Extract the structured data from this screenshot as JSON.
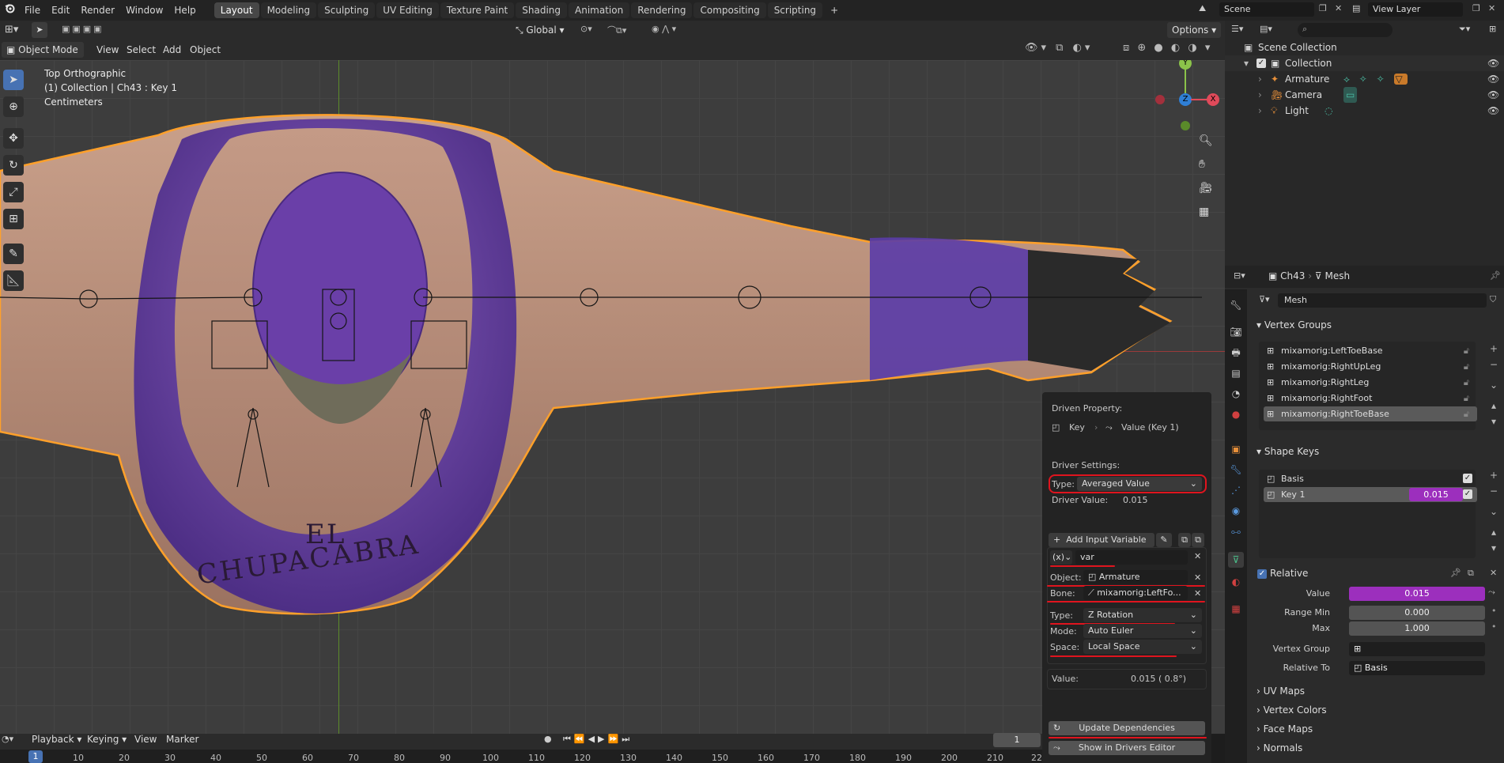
{
  "topbar": {
    "menus": [
      "File",
      "Edit",
      "Render",
      "Window",
      "Help"
    ],
    "workspaces": [
      "Layout",
      "Modeling",
      "Sculpting",
      "UV Editing",
      "Texture Paint",
      "Shading",
      "Animation",
      "Rendering",
      "Compositing",
      "Scripting"
    ],
    "active_workspace": "Layout",
    "add_tab": "+",
    "scene": "Scene",
    "view_layer": "View Layer"
  },
  "vp_toolbar": {
    "transform_orientation": "Global",
    "options": "Options"
  },
  "vp_header": {
    "mode": "Object Mode",
    "view": "View",
    "select": "Select",
    "add": "Add",
    "object": "Object"
  },
  "viewport": {
    "view_name": "Top Orthographic",
    "collection_info": "(1) Collection | Ch43 : Key 1",
    "units": "Centimeters",
    "shirt_text_1": "EL",
    "shirt_text_2": "CHUPACABRA",
    "gizmo_y": "Y",
    "gizmo_z": "Z",
    "gizmo_x": "X"
  },
  "driver_popover": {
    "driven_property_label": "Driven Property:",
    "driven_key": "Key",
    "driven_value": "Value (Key 1)",
    "driver_settings_label": "Driver Settings:",
    "type_label": "Type:",
    "type_value": "Averaged Value",
    "driver_value_label": "Driver Value:",
    "driver_value": "0.015",
    "add_input_variable": "Add Input Variable",
    "var_type": "(x)",
    "var_name": "var",
    "object_label": "Object:",
    "object_value": "Armature",
    "bone_label": "Bone:",
    "bone_value": "mixamorig:LeftFo...",
    "vtype_label": "Type:",
    "vtype_value": "Z Rotation",
    "mode_label": "Mode:",
    "mode_value": "Auto Euler",
    "space_label": "Space:",
    "space_value": "Local Space",
    "value_label": "Value:",
    "value_value": "0.015 ( 0.8°)",
    "update_dependencies": "Update Dependencies",
    "show_in_drivers_editor": "Show in Drivers Editor",
    "highlight_color": "#e0141e"
  },
  "outliner": {
    "scene_collection": "Scene Collection",
    "collection": "Collection",
    "items": [
      "Armature",
      "Camera",
      "Light"
    ]
  },
  "properties": {
    "breadcrumb_object": "Ch43",
    "breadcrumb_data": "Mesh",
    "mesh_name": "Mesh",
    "vertex_groups_title": "Vertex Groups",
    "vertex_groups": [
      "mixamorig:LeftToeBase",
      "mixamorig:RightUpLeg",
      "mixamorig:RightLeg",
      "mixamorig:RightFoot",
      "mixamorig:RightToeBase"
    ],
    "shape_keys_title": "Shape Keys",
    "shape_keys": [
      {
        "name": "Basis",
        "value": ""
      },
      {
        "name": "Key 1",
        "value": "0.015"
      }
    ],
    "relative_label": "Relative",
    "value_label": "Value",
    "value": "0.015",
    "range_min_label": "Range Min",
    "range_min": "0.000",
    "max_label": "Max",
    "max": "1.000",
    "vertex_group_label": "Vertex Group",
    "relative_to_label": "Relative To",
    "relative_to": "Basis",
    "collapsed_sections": [
      "UV Maps",
      "Vertex Colors",
      "Face Maps",
      "Normals"
    ],
    "driven_color": "#9c2fbd"
  },
  "timeline": {
    "playback": "Playback",
    "keying": "Keying",
    "view": "View",
    "marker": "Marker",
    "current_frame": "1",
    "ruler": [
      "1",
      "10",
      "20",
      "30",
      "40",
      "50",
      "60",
      "70",
      "80",
      "90",
      "100",
      "110",
      "120",
      "130",
      "140",
      "150",
      "160",
      "170",
      "180",
      "190",
      "200",
      "210",
      "22"
    ]
  }
}
